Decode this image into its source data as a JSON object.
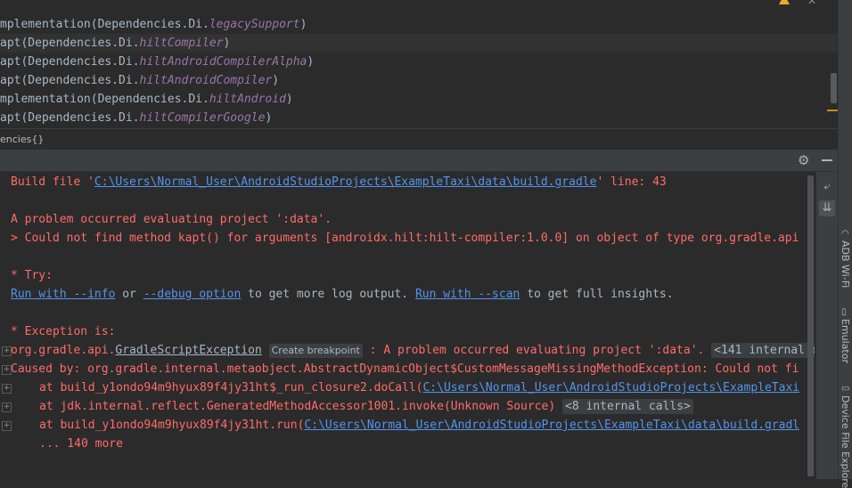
{
  "editor": {
    "lines": [
      {
        "prefix": "mplementation(Dependencies.Di.",
        "ident": "legacySupport",
        "suffix": ")"
      },
      {
        "prefix": "apt(Dependencies.Di.",
        "ident": "hiltCompiler",
        "suffix": ")"
      },
      {
        "prefix": "apt(Dependencies.Di.",
        "ident": "hiltAndroidCompilerAlpha",
        "suffix": ")"
      },
      {
        "prefix": "apt(Dependencies.Di.",
        "ident": "hiltAndroidCompiler",
        "suffix": ")"
      },
      {
        "prefix": "mplementation(Dependencies.Di.",
        "ident": "hiltAndroid",
        "suffix": ")"
      },
      {
        "prefix": "apt(Dependencies.Di.",
        "ident": "hiltCompilerGoogle",
        "suffix": ")"
      }
    ],
    "current_line_index": 1
  },
  "breadcrumb": {
    "text": "encies{}"
  },
  "console": {
    "build_file_prefix": "Build file '",
    "build_file_path": "C:\\Users\\Normal_User\\AndroidStudioProjects\\ExampleTaxi\\data\\build.gradle",
    "build_file_suffix": "' line: 43",
    "problem": "A problem occurred evaluating project ':data'.",
    "could_not": "> Could not find method kapt() for arguments [androidx.hilt:hilt-compiler:1.0.0] on object of type org.gradle.api",
    "try_label": "* Try:",
    "run_info": "Run with --info",
    "or": " or ",
    "debug_option": "--debug option",
    "more_log": " to get more log output. ",
    "run_scan": "Run with --scan",
    "full_insights": " to get full insights.",
    "exception_label": "* Exception is:",
    "exc_prefix": "org.gradle.api.",
    "exc_class": "GradleScriptException",
    "create_breakpoint": "Create breakpoint",
    "exc_message": " : A problem occurred evaluating project ':data'.",
    "internal_calls_1": "<141 internal c",
    "caused_by": "Caused by: org.gradle.internal.metaobject.AbstractDynamicObject$CustomMessageMissingMethodException: Could not fi",
    "at1_prefix": "at build_y1ondo94m9hyux89f4jy31ht$_run_closure2.doCall(",
    "at1_link": "C:\\Users\\Normal_User\\AndroidStudioProjects\\ExampleTaxi",
    "at2": "at jdk.internal.reflect.GeneratedMethodAccessor1001.invoke(Unknown Source)",
    "internal_calls_2": "<8 internal calls>",
    "at3_prefix": "at build_y1ondo94m9hyux89f4jy31ht.run(",
    "at3_link": "C:\\Users\\Normal_User\\AndroidStudioProjects\\ExampleTaxi\\data\\build.gradl",
    "more": "... 140 more"
  },
  "right_strip": {
    "adb_wifi": "ADB Wi-Fi",
    "emulator": "Emulator",
    "device_explorer": "Device File Explore"
  },
  "icons": {
    "warning": "warning-icon",
    "close": "close-icon",
    "settings": "gear-icon",
    "minimize": "minimize-icon",
    "soft_wrap": "soft-wrap-icon",
    "scroll_to_end": "scroll-to-end-icon"
  },
  "colors": {
    "error_text": "#ff6b68",
    "link": "#5394ec",
    "background": "#2b2b2b",
    "panel": "#3c3f41",
    "warning": "#f0a732"
  }
}
